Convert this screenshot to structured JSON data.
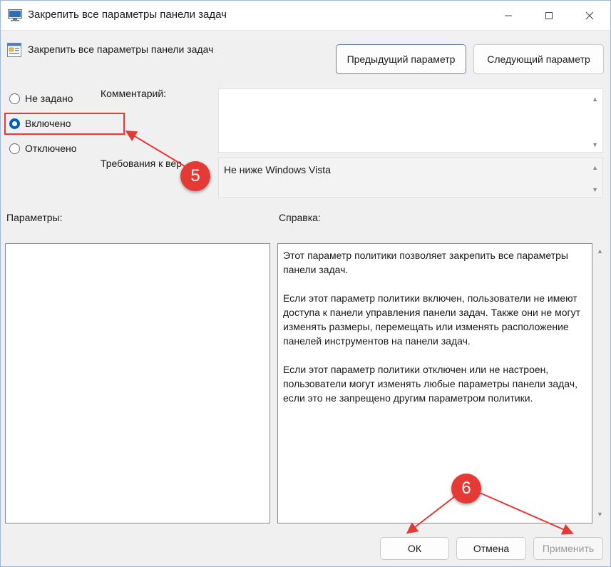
{
  "window": {
    "title": "Закрепить все параметры панели задач",
    "controls": {
      "minimize": "—",
      "maximize": "☐",
      "close": "✕"
    }
  },
  "policy": {
    "name": "Закрепить все параметры панели задач"
  },
  "nav": {
    "previous": "Предыдущий параметр",
    "next": "Следующий параметр"
  },
  "state": {
    "options": [
      {
        "label": "Не задано",
        "checked": false
      },
      {
        "label": "Включено",
        "checked": true
      },
      {
        "label": "Отключено",
        "checked": false
      }
    ]
  },
  "comment": {
    "label": "Комментарий:",
    "value": ""
  },
  "requirements": {
    "label": "Требования к вер",
    "value": "Не ниже Windows Vista"
  },
  "options_panel": {
    "label": "Параметры:"
  },
  "help": {
    "label": "Справка:",
    "text": "Этот параметр политики позволяет закрепить все параметры панели задач.\n\nЕсли этот параметр политики включен, пользователи не имеют доступа к панели управления панели задач. Также они не могут изменять размеры, перемещать или изменять расположение панелей инструментов на панели задач.\n\nЕсли этот параметр политики отключен или не настроен, пользователи могут изменять любые параметры панели задач, если это не запрещено другим параметром политики."
  },
  "footer": {
    "ok": "ОК",
    "cancel": "Отмена",
    "apply": "Применить"
  },
  "annotations": {
    "step5": "5",
    "step6": "6",
    "color": "#e53935"
  }
}
